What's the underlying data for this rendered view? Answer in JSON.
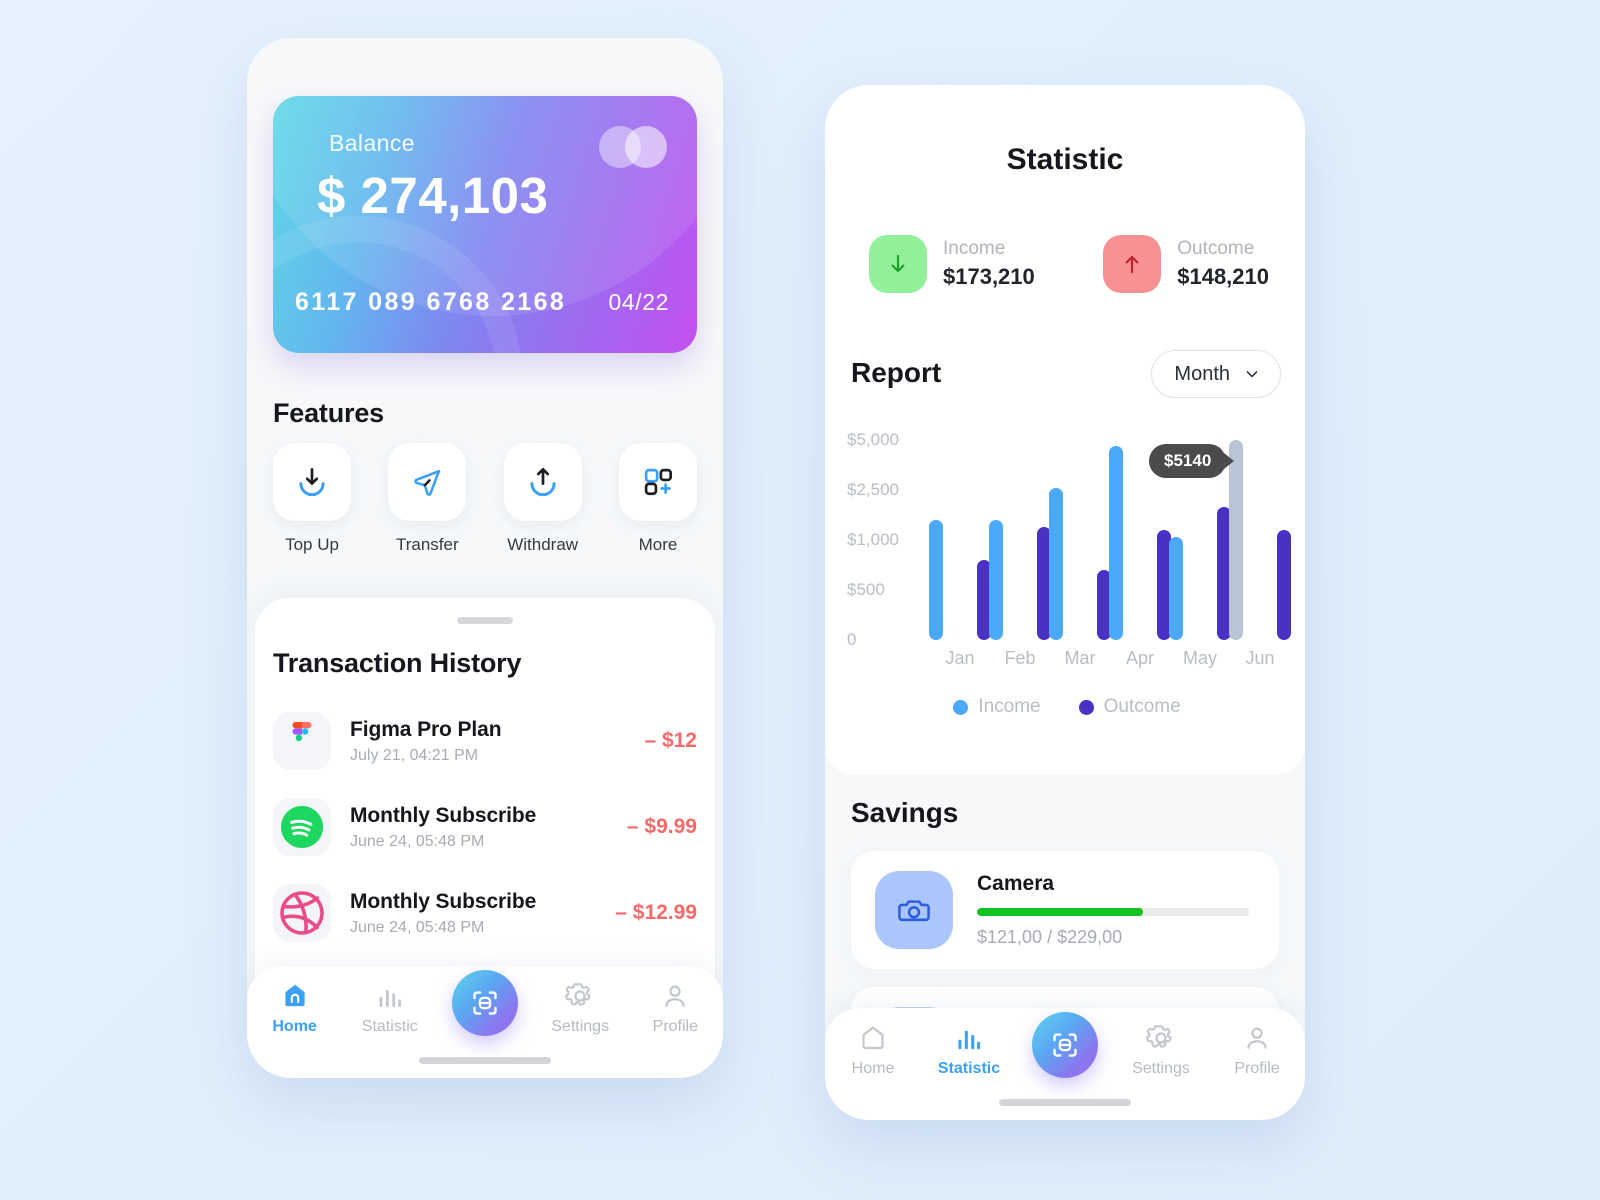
{
  "theme": {
    "accent": "#3ba0f8",
    "income_color": "#4ca8fb",
    "outcome_color": "#4a31c4",
    "muted_bar_color": "#b9c5d4",
    "negative_color": "#f76a6a",
    "progress_color": "#17c11d",
    "page_background": "#e2effc"
  },
  "home": {
    "card": {
      "balance_label": "Balance",
      "balance_amount": "$ 274,103",
      "card_number": "6117 089 6768 2168",
      "expiry": "04/22"
    },
    "features_title": "Features",
    "features": [
      {
        "label": "Top Up",
        "icon": "download-arrow-icon"
      },
      {
        "label": "Transfer",
        "icon": "send-paper-plane-icon"
      },
      {
        "label": "Withdraw",
        "icon": "upload-arrow-icon"
      },
      {
        "label": "More",
        "icon": "grid-plus-icon"
      }
    ],
    "transactions_title": "Transaction History",
    "transactions": [
      {
        "name": "Figma Pro Plan",
        "date": "July 21, 04:21 PM",
        "amount": "– $12",
        "icon": "figma-logo-icon"
      },
      {
        "name": "Monthly Subscribe",
        "date": "June 24, 05:48 PM",
        "amount": "– $9.99",
        "icon": "spotify-logo-icon"
      },
      {
        "name": "Monthly Subscribe",
        "date": "June 24, 05:48 PM",
        "amount": "– $12.99",
        "icon": "dribbble-logo-icon"
      }
    ],
    "nav": {
      "active": "Home",
      "items": [
        {
          "label": "Home",
          "icon": "home-icon"
        },
        {
          "label": "Statistic",
          "icon": "bar-chart-icon"
        },
        {
          "label": "",
          "icon": "scan-icon"
        },
        {
          "label": "Settings",
          "icon": "gear-icon"
        },
        {
          "label": "Profile",
          "icon": "person-icon"
        }
      ]
    }
  },
  "statistic": {
    "title": "Statistic",
    "summary": [
      {
        "label": "Income",
        "value": "$173,210",
        "icon": "arrow-down-icon",
        "box_color": "#93f09a",
        "arrow_color": "#19a32a"
      },
      {
        "label": "Outcome",
        "value": "$148,210",
        "icon": "arrow-up-icon",
        "box_color": "#f79193",
        "arrow_color": "#c0222a"
      }
    ],
    "report_title": "Report",
    "period_selector": {
      "value": "Month",
      "icon": "chevron-down-icon"
    },
    "savings_title": "Savings",
    "savings": [
      {
        "name": "Camera",
        "current": "$121,00",
        "target": "$229,00",
        "progress_text": "$121,00 / $229,00",
        "progress_pct": 61,
        "icon": "camera-icon"
      }
    ],
    "nav": {
      "active": "Statistic",
      "items": [
        {
          "label": "Home",
          "icon": "home-icon"
        },
        {
          "label": "Statistic",
          "icon": "bar-chart-icon"
        },
        {
          "label": "",
          "icon": "scan-icon"
        },
        {
          "label": "Settings",
          "icon": "gear-icon"
        },
        {
          "label": "Profile",
          "icon": "person-icon"
        }
      ]
    }
  },
  "chart_data": {
    "type": "bar",
    "title": "Report",
    "xlabel": "",
    "ylabel": "",
    "categories": [
      "Jan",
      "Feb",
      "Mar",
      "Apr",
      "May",
      "Jun"
    ],
    "ytick_labels": [
      "$5,000",
      "$2,500",
      "$1,000",
      "$500",
      "0"
    ],
    "ylim": [
      0,
      5140
    ],
    "grid": false,
    "legend_position": "bottom-center",
    "annotation": {
      "text": "$5140",
      "attached_to": "Jun / Income"
    },
    "highlighted_bar": {
      "category": "Jun",
      "series": "Income"
    },
    "series": [
      {
        "name": "Income",
        "color": "#4ca8fb",
        "values": [
          1600,
          1600,
          2600,
          4700,
          1100,
          5140
        ]
      },
      {
        "name": "Outcome",
        "color": "#4a31c4",
        "values": [
          800,
          1400,
          700,
          1300,
          2000,
          1300
        ]
      }
    ]
  }
}
